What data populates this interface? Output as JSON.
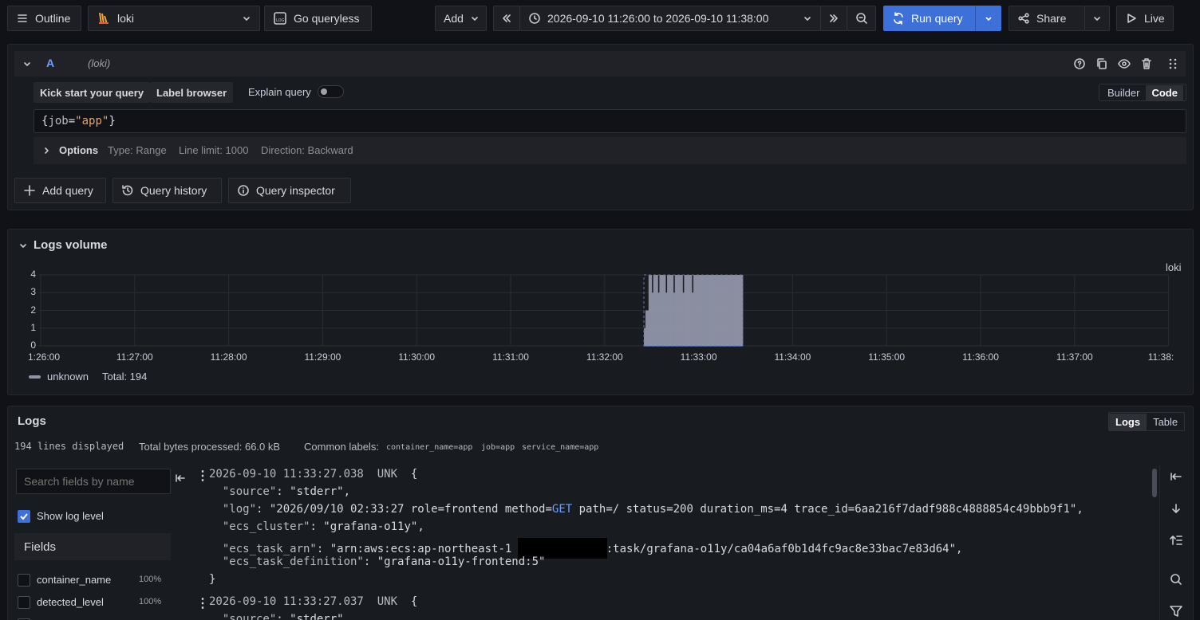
{
  "toolbar": {
    "outline": "Outline",
    "datasource": "loki",
    "go_queryless": "Go queryless",
    "add": "Add",
    "time_range": "2026-09-10 11:26:00 to 2026-09-10 11:38:00",
    "run_query": "Run query",
    "share": "Share",
    "live": "Live"
  },
  "query": {
    "ref_id": "A",
    "datasource_label": "(loki)",
    "kick_start": "Kick start your query",
    "label_browser": "Label browser",
    "explain_query": "Explain query",
    "mode_builder": "Builder",
    "mode_code": "Code",
    "expression_job_key": "job",
    "expression_eq": "=",
    "expression_value": "\"app\"",
    "options_label": "Options",
    "type": "Type: Range",
    "line_limit": "Line limit: 1000",
    "direction": "Direction: Backward",
    "add_query": "Add query",
    "query_history": "Query history",
    "query_inspector": "Query inspector"
  },
  "volume": {
    "title": "Logs volume",
    "series_label": "loki",
    "legend_name": "unknown",
    "legend_total": "Total: 194"
  },
  "chart_data": {
    "type": "bar",
    "title": "",
    "xlabel": "",
    "ylabel": "",
    "ylim": [
      0,
      4
    ],
    "yticks": [
      "4",
      "3",
      "2",
      "1",
      "0"
    ],
    "xticks": [
      "1:26:00",
      "11:27:00",
      "11:28:00",
      "11:29:00",
      "11:30:00",
      "11:31:00",
      "11:32:00",
      "11:33:00",
      "11:34:00",
      "11:35:00",
      "11:36:00",
      "11:37:00",
      "11:38:"
    ],
    "series": [
      {
        "name": "unknown",
        "color": "#8f94a6",
        "description_range": [
          "11:32:25",
          "11:33:30"
        ],
        "values": [
          1,
          2,
          2,
          4,
          4,
          3,
          4,
          4,
          4,
          3,
          4,
          4,
          4,
          4,
          3,
          4,
          4,
          4,
          4,
          3,
          4,
          4,
          4,
          4,
          4,
          3,
          4,
          4,
          4,
          4,
          4,
          3,
          4,
          4,
          4,
          4,
          4,
          4,
          4,
          4,
          4,
          4,
          4,
          4,
          4,
          4,
          4,
          4,
          4,
          4,
          4,
          4,
          4,
          4,
          4,
          4,
          4,
          4,
          4,
          4,
          4,
          4,
          4,
          4
        ]
      }
    ],
    "legend": "bottom-left",
    "grid": true
  },
  "logs": {
    "title": "Logs",
    "lines_displayed": "194 lines displayed",
    "bytes": "Total bytes processed: 66.0 kB",
    "common_labels": "Common labels:",
    "labels": [
      "container_name=app",
      "job=app",
      "service_name=app"
    ],
    "view_logs": "Logs",
    "view_table": "Table",
    "search_placeholder": "Search fields by name",
    "show_log_level": "Show log level",
    "fields_title": "Fields",
    "fields": [
      {
        "name": "container_name",
        "pct": "100%"
      },
      {
        "name": "detected_level",
        "pct": "100%"
      }
    ],
    "entries": [
      {
        "ts": "2026-09-10 11:33:27.038",
        "level": "UNK",
        "source_key": "\"source\"",
        "source_val": "\"stderr\"",
        "log_key": "\"log\"",
        "log_val_a": "\"2026/09/10 02:33:27 role=frontend method=",
        "log_method": "GET",
        "log_val_b": " path=/ status=200 duration_ms=4 trace_id=6aa216f7dadf988c4888854c49bbb9f1\"",
        "cluster_key": "\"ecs_cluster\"",
        "cluster_val": "\"grafana-o11y\"",
        "arn_key": "\"ecs_task_arn\"",
        "arn_a": "\"arn:aws:ecs:ap-northeast-1",
        "arn_b": ":task/grafana-o11y/ca04a6af0b1d4fc9ac8e33bac7e83d64\"",
        "def_key": "\"ecs_task_definition\"",
        "def_val": "\"grafana-o11y-frontend:5\""
      },
      {
        "ts": "2026-09-10 11:33:27.037",
        "level": "UNK",
        "source_key": "\"source\"",
        "source_val": "\"stderr\""
      }
    ]
  }
}
